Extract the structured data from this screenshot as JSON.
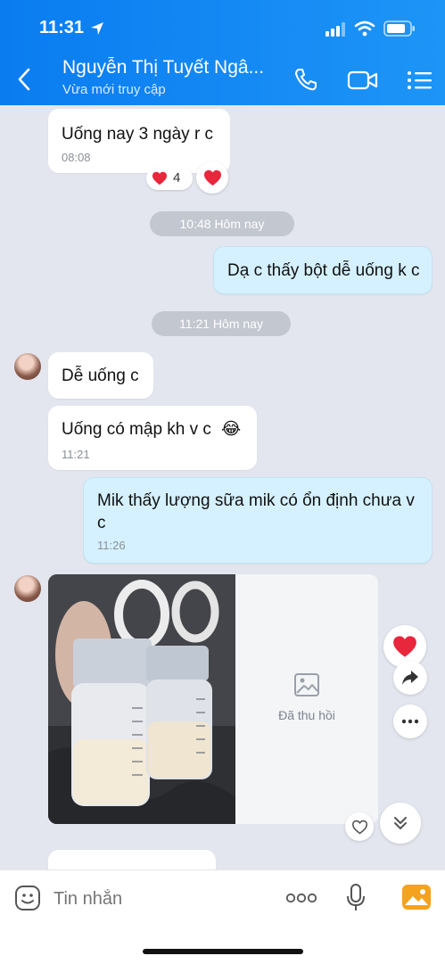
{
  "status_bar": {
    "time": "11:31"
  },
  "header": {
    "title": "Nguyễn Thị Tuyết Ngâ...",
    "subtitle": "Vừa mới truy cập"
  },
  "messages": {
    "m1_text": "Uống nay 3 ngày r c",
    "m1_time": "08:08",
    "m1_reaction_count": "4",
    "sep1": "10:48 Hôm nay",
    "m2_text": "Dạ c thấy bột dễ uống k c",
    "sep2": "11:21 Hôm nay",
    "m3_text": "Dễ uống c",
    "m4_text": "Uống có mập kh v c",
    "m4_emoji": "😂",
    "m4_time": "11:21",
    "m5_text": "Mik thấy lượng sữa mik có ổn định chưa v c",
    "m5_time": "11:26",
    "recalled_label": "Đã thu hồi"
  },
  "input": {
    "placeholder": "Tin nhắn"
  },
  "colors": {
    "header": "#1a8cf5",
    "bubble_me": "#d5f1ff",
    "bubble_other": "#ffffff",
    "heart": "#e8263c"
  }
}
